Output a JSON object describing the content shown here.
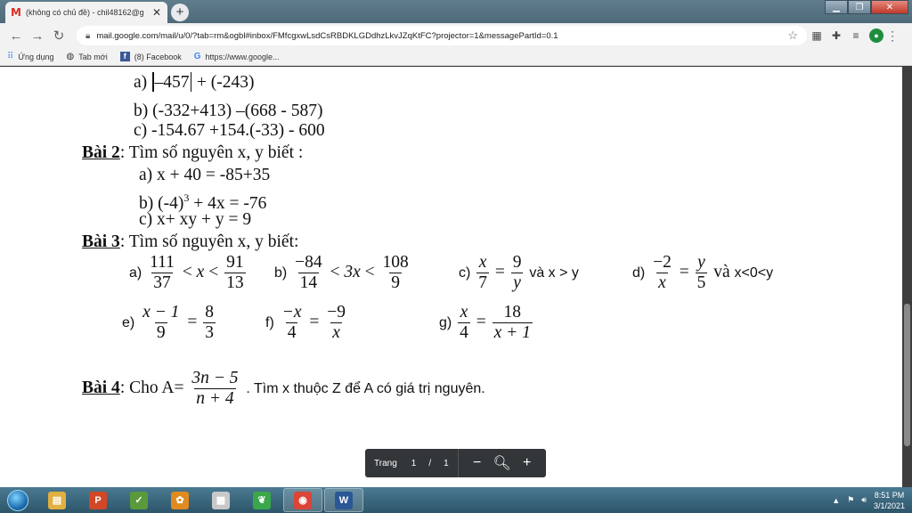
{
  "browser": {
    "tab_title": "(không có chủ đề) - chil48162@g",
    "tab_favicon": "M",
    "newtab_label": "+",
    "url": "mail.google.com/mail/u/0/?tab=rm&ogbl#inbox/FMfcgxwLsdCsRBDKLGDdhzLkvJZqKtFC?projector=1&messagePartId=0.1",
    "bookmarks": [
      {
        "icon": "apps-grid-icon",
        "label": "Ứng dụng"
      },
      {
        "icon": "globe-icon",
        "label": "Tab mới"
      },
      {
        "icon": "facebook-icon",
        "label": "(8) Facebook"
      },
      {
        "icon": "google-icon",
        "label": "https://www.google..."
      }
    ]
  },
  "doc": {
    "bai1": {
      "a_label": "a)",
      "a_abs_value": "–457",
      "a_rest": "+ (-243)",
      "b": "b) (-332+413) –(668 - 587)",
      "c": "c) -154.67 +154.(-33) - 600"
    },
    "bai2": {
      "title": "Bài 2",
      "intro": ": Tìm số nguyên  x, y biết :",
      "a": "a)    x + 40 =  -85+35",
      "b_pre": "b)  (-4)",
      "b_exp": "3",
      "b_post": " + 4x  =  -76",
      "c": "c)  x+  xy  + y = 9"
    },
    "bai3": {
      "title": "Bài 3",
      "intro": ": Tìm số nguyên  x, y biết:",
      "a": {
        "label": "a)",
        "n1": "111",
        "d1": "37",
        "op1": "<",
        "mid": "x",
        "op2": "<",
        "n2": "91",
        "d2": "13"
      },
      "b": {
        "label": "b)",
        "n1": "−84",
        "d1": "14",
        "op1": "<",
        "mid": "3x",
        "op2": "<",
        "n2": "108",
        "d2": "9"
      },
      "c": {
        "label": "c)",
        "n1": "x",
        "d1": "7",
        "eq": "=",
        "n2": "9",
        "d2": "y",
        "tail": "và x > y"
      },
      "d": {
        "label": "d)",
        "n1": "−2",
        "d1": "x",
        "eq": "=",
        "n2": "y",
        "d2": "5",
        "tail_va": "và",
        "tail": "x<0<y"
      },
      "e": {
        "label": "e)",
        "n1": "x − 1",
        "d1": "9",
        "eq": "=",
        "n2": "8",
        "d2": "3"
      },
      "f": {
        "label": "f)",
        "n1": "−x",
        "d1": "4",
        "eq": "=",
        "n2": "−9",
        "d2": "x"
      },
      "g": {
        "label": "g)",
        "n1": "x",
        "d1": "4",
        "eq": "=",
        "n2": "18",
        "d2": "x + 1"
      }
    },
    "bai4": {
      "title": "Bài 4",
      "pre": ": Cho A=",
      "num": "3n − 5",
      "den": "n + 4",
      "post": ". Tìm x thuộc Z để A có giá trị nguyên."
    }
  },
  "pdf_toolbar": {
    "page_label": "Trang",
    "current_page": "1",
    "slash": "/",
    "total_pages": "1",
    "zoom_out": "−",
    "zoom_in": "+"
  },
  "taskbar": {
    "apps": [
      {
        "icon": "file-explorer-icon",
        "glyph": "▤",
        "color": "#e0b040"
      },
      {
        "icon": "powerpoint-icon",
        "glyph": "P",
        "color": "#d24726"
      },
      {
        "icon": "chart-app-icon",
        "glyph": "✓",
        "color": "#5a9a3a"
      },
      {
        "icon": "gear-app-icon",
        "glyph": "✿",
        "color": "#e08a20"
      },
      {
        "icon": "paint-icon",
        "glyph": "▦",
        "color": "#c8c8c8"
      },
      {
        "icon": "green-app-icon",
        "glyph": "❦",
        "color": "#3aa84a"
      },
      {
        "icon": "chrome-icon",
        "glyph": "◉",
        "color": "#db4437"
      },
      {
        "icon": "word-icon",
        "glyph": "W",
        "color": "#2b5797"
      }
    ],
    "clock_time": "8:51 PM",
    "clock_date": "3/1/2021"
  }
}
